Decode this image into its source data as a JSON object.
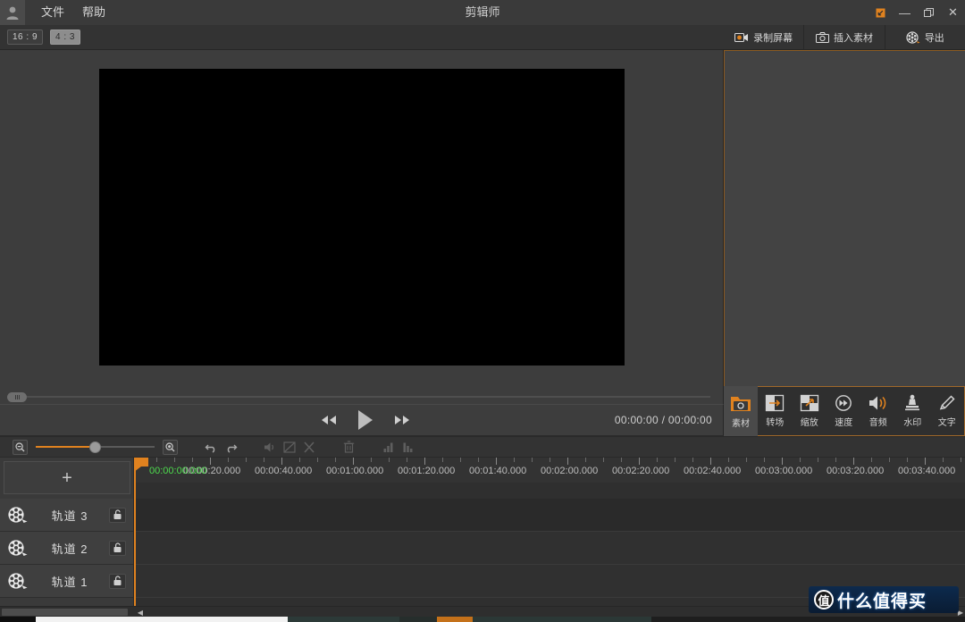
{
  "window": {
    "title": "剪辑师",
    "menus": [
      {
        "label": "文件"
      },
      {
        "label": "帮助"
      }
    ],
    "controls": {
      "restore_label": "↙",
      "minimize_label": "—",
      "maximize_label": "❐",
      "close_label": "✕"
    },
    "accent_color": "#e0821f"
  },
  "aspect_bar": {
    "options": [
      {
        "label": "16 : 9",
        "selected": false
      },
      {
        "label": "4 : 3",
        "selected": true
      }
    ]
  },
  "preview": {
    "canvas_color": "#000000",
    "fullscreen_icon": "fullscreen-icon",
    "scrub_handle": "scrub-handle"
  },
  "transport": {
    "prev_icon": "rewind-icon",
    "play_icon": "play-icon",
    "next_icon": "fast-forward-icon",
    "time_display": "00:00:00 / 00:00:00"
  },
  "right_panel": {
    "tabs": [
      {
        "label": "录制屏幕",
        "icon": "video-camera-icon"
      },
      {
        "label": "插入素材",
        "icon": "camera-icon"
      },
      {
        "label": "导出",
        "icon": "film-reel-icon"
      }
    ],
    "tools": [
      {
        "label": "素材",
        "icon": "folder-camera-icon",
        "active": true
      },
      {
        "label": "转场",
        "icon": "transition-arrow-icon",
        "active": false
      },
      {
        "label": "缩放",
        "icon": "scale-arrow-icon",
        "active": false
      },
      {
        "label": "速度",
        "icon": "speed-icon",
        "active": false
      },
      {
        "label": "音频",
        "icon": "speaker-icon",
        "active": false
      },
      {
        "label": "水印",
        "icon": "stamp-icon",
        "active": false
      },
      {
        "label": "文字",
        "icon": "pencil-icon",
        "active": false
      }
    ]
  },
  "timeline_toolbar": {
    "zoom_out_icon": "zoom-out-icon",
    "zoom_in_icon": "zoom-in-icon",
    "zoom_value": 45,
    "buttons": [
      {
        "name": "undo-button",
        "icon": "undo-icon",
        "disabled": false
      },
      {
        "name": "redo-button",
        "icon": "redo-icon",
        "disabled": false
      },
      {
        "name": "mute-button",
        "icon": "speaker-icon",
        "disabled": true
      },
      {
        "name": "crop-button",
        "icon": "crop-icon",
        "disabled": true
      },
      {
        "name": "cut-button",
        "icon": "scissors-icon",
        "disabled": true
      },
      {
        "name": "delete-button",
        "icon": "trash-icon",
        "disabled": true
      },
      {
        "name": "levels-up-button",
        "icon": "bars-up-icon",
        "disabled": true
      },
      {
        "name": "levels-down-button",
        "icon": "bars-down-icon",
        "disabled": true
      }
    ]
  },
  "timeline": {
    "add_track_label": "+",
    "current_time": "00:00:00.000",
    "ruler_labels": [
      "00:00:20.000",
      "00:00:40.000",
      "00:01:00.000",
      "00:01:20.000",
      "00:01:40.000",
      "00:02:00.000",
      "00:02:20.000",
      "00:02:40.000",
      "00:03:00.000",
      "00:03:20.000",
      "00:03:40.000"
    ],
    "tracks": [
      {
        "label": "轨道 3",
        "icon": "film-reel-icon",
        "lock_icon": "unlock-icon"
      },
      {
        "label": "轨道 2",
        "icon": "film-reel-icon",
        "lock_icon": "unlock-icon"
      },
      {
        "label": "轨道 1",
        "icon": "film-reel-icon",
        "lock_icon": "unlock-icon"
      }
    ]
  },
  "scrollbar": {
    "left_arrow": "◀",
    "right_arrow": "▶"
  },
  "watermark": {
    "badge": "值",
    "text": "什么值得买"
  }
}
